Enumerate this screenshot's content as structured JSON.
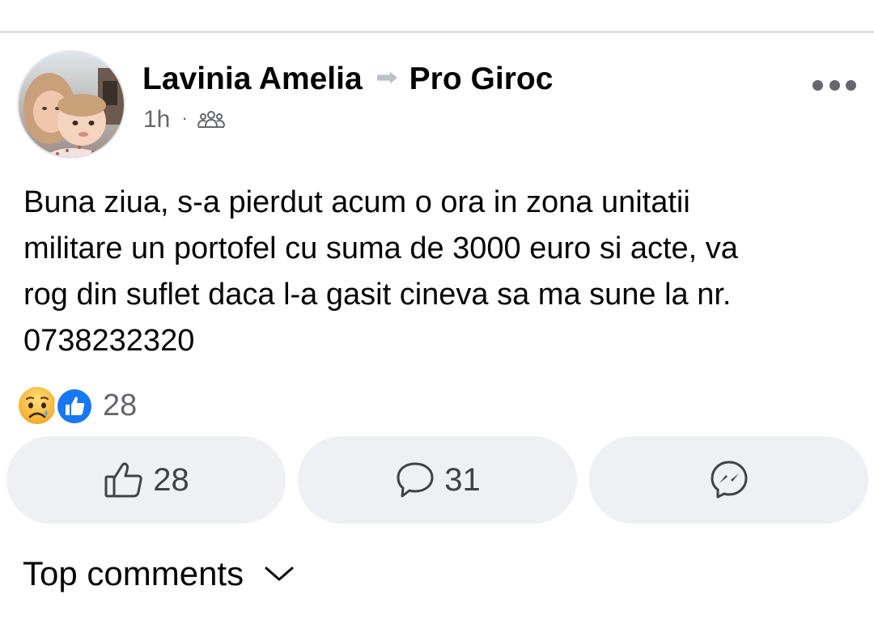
{
  "post": {
    "author": "Lavinia Amelia",
    "group": "Pro Giroc",
    "time": "1h",
    "separator": "·",
    "audience_icon": "group-icon",
    "more_icon": "more-options-icon",
    "text_lines": [
      "Buna ziua, s-a pierdut acum o ora in zona unitatii",
      "militare un portofel cu suma de 3000 euro si acte, va",
      "rog din suflet daca l-a gasit cineva sa ma sune la nr.",
      "0738232320"
    ]
  },
  "reactions": {
    "types": [
      "sad-emoji",
      "like-emoji"
    ],
    "count": "28"
  },
  "actions": {
    "like_count": "28",
    "comment_count": "31",
    "share_icon": "messenger-icon"
  },
  "comments": {
    "label": "Top comments"
  },
  "colors": {
    "like_blue": "#1877f2",
    "secondary_text": "#65676b",
    "button_bg": "#eff0f3",
    "sad_yellow": "#f7b125"
  }
}
